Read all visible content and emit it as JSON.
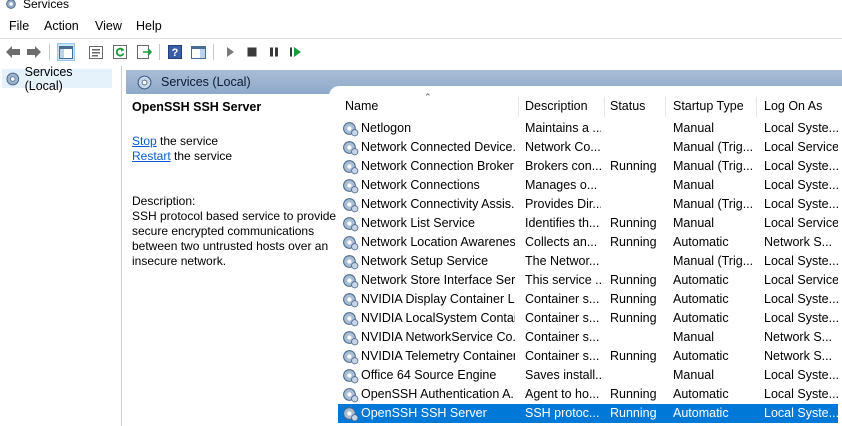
{
  "window": {
    "title": "Services"
  },
  "menu": [
    "File",
    "Action",
    "View",
    "Help"
  ],
  "toolbar": {
    "buttons": [
      "back-icon",
      "forward-icon",
      "show-hide-console-tree-icon",
      "properties-icon",
      "refresh-icon",
      "export-list-icon",
      "help-icon",
      "show-hide-action-pane-icon",
      "start-service-icon",
      "stop-service-icon",
      "pause-service-icon",
      "restart-service-icon"
    ]
  },
  "scope": {
    "item": "Services (Local)"
  },
  "pane": {
    "header": "Services (Local)"
  },
  "detail": {
    "service_name": "OpenSSH SSH Server",
    "stop_link": "Stop",
    "stop_rest": " the service",
    "restart_link": "Restart",
    "restart_rest": " the service",
    "description_label": "Description:",
    "description_lines": [
      "SSH protocol based service to provide",
      "secure encrypted communications",
      "between two untrusted hosts over an",
      "insecure network."
    ]
  },
  "columns": [
    "Name",
    "Description",
    "Status",
    "Startup Type",
    "Log On As"
  ],
  "rows": [
    [
      "Netlogon",
      "Maintains a ...",
      "",
      "Manual",
      "Local Syste..."
    ],
    [
      "Network Connected Device...",
      "Network Co...",
      "",
      "Manual (Trig...",
      "Local Service"
    ],
    [
      "Network Connection Broker",
      "Brokers con...",
      "Running",
      "Manual (Trig...",
      "Local Syste..."
    ],
    [
      "Network Connections",
      "Manages o...",
      "",
      "Manual",
      "Local Syste..."
    ],
    [
      "Network Connectivity Assis...",
      "Provides Dir...",
      "",
      "Manual (Trig...",
      "Local Syste..."
    ],
    [
      "Network List Service",
      "Identifies th...",
      "Running",
      "Manual",
      "Local Service"
    ],
    [
      "Network Location Awareness",
      "Collects an...",
      "Running",
      "Automatic",
      "Network S..."
    ],
    [
      "Network Setup Service",
      "The Networ...",
      "",
      "Manual (Trig...",
      "Local Syste..."
    ],
    [
      "Network Store Interface Ser...",
      "This service ...",
      "Running",
      "Automatic",
      "Local Service"
    ],
    [
      "NVIDIA Display Container LS",
      "Container s...",
      "Running",
      "Automatic",
      "Local Syste..."
    ],
    [
      "NVIDIA LocalSystem Contai...",
      "Container s...",
      "Running",
      "Automatic",
      "Local Syste..."
    ],
    [
      "NVIDIA NetworkService Co...",
      "Container s...",
      "",
      "Manual",
      "Network S..."
    ],
    [
      "NVIDIA Telemetry Container",
      "Container s...",
      "Running",
      "Automatic",
      "Network S..."
    ],
    [
      "Office 64 Source Engine",
      "Saves install...",
      "",
      "Manual",
      "Local Syste..."
    ],
    [
      "OpenSSH Authentication A...",
      "Agent to ho...",
      "Running",
      "Automatic",
      "Local Syste..."
    ],
    [
      "OpenSSH SSH Server",
      "SSH protoc...",
      "Running",
      "Automatic",
      "Local Syste..."
    ]
  ],
  "selected_row": 15,
  "colors": {
    "selection": "#0078d7",
    "header_band": "#a9bdd6",
    "link": "#0b5ad1",
    "scope_selection": "#e5f1fb"
  }
}
